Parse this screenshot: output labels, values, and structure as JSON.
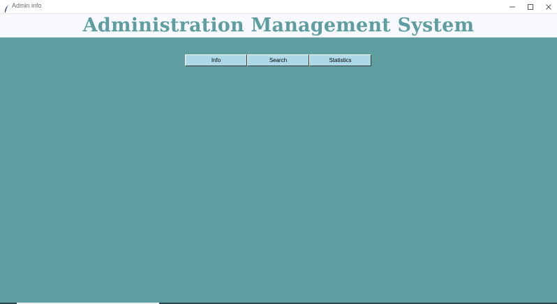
{
  "window": {
    "title": "Admin info",
    "icon": "feather-icon",
    "controls": [
      "minimize-icon",
      "maximize-icon",
      "close-icon"
    ]
  },
  "header": {
    "title": "Administration Management System"
  },
  "nav": {
    "info_label": "Info",
    "search_label": "Search",
    "statistics_label": "Statistics"
  },
  "colors": {
    "background": "#5f9ea0",
    "header_background": "#f8f8ff",
    "title_color": "#5f9ea0",
    "button_background": "#add8e6"
  }
}
